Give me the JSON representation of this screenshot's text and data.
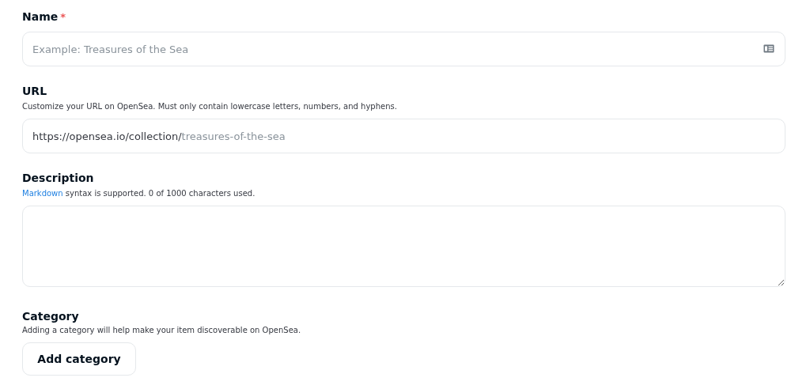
{
  "fields": [
    {
      "kind": "input",
      "label": "Name",
      "required": true,
      "required_mark": "*",
      "placeholder": "Example: Treasures of the Sea"
    },
    {
      "kind": "url",
      "label": "URL",
      "required": false,
      "help": "Customize your URL on OpenSea. Must only contain lowercase letters, numbers, and hyphens.",
      "prefix": "https://opensea.io/collection/",
      "placeholder": "treasures-of-the-sea"
    },
    {
      "kind": "textarea",
      "label": "Description",
      "required": false,
      "help_link": "Markdown",
      "help": "syntax is supported. 0 of 1000 characters used."
    },
    {
      "kind": "button",
      "label": "Category",
      "required": false,
      "help": "Adding a category will help make your item discoverable on OpenSea.",
      "button": "Add category"
    }
  ]
}
